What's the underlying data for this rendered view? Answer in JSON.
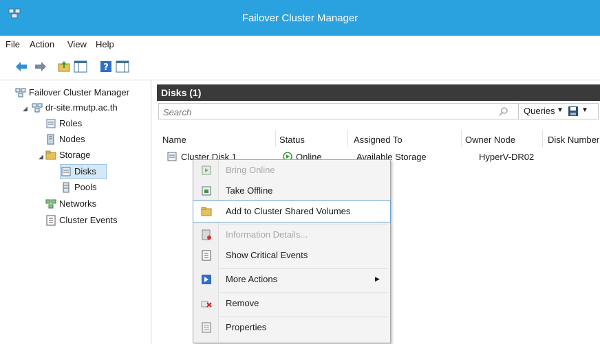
{
  "window": {
    "title": "Failover Cluster Manager"
  },
  "menubar": {
    "items": [
      "File",
      "Action",
      "View",
      "Help"
    ]
  },
  "tree": {
    "root": "Failover Cluster Manager",
    "cluster": "dr-site.rmutp.ac.th",
    "roles": "Roles",
    "nodes": "Nodes",
    "storage": "Storage",
    "disks": "Disks",
    "pools": "Pools",
    "networks": "Networks",
    "events": "Cluster Events"
  },
  "pane": {
    "title": "Disks (1)",
    "search_placeholder": "Search",
    "queries_label": "Queries"
  },
  "table": {
    "columns": [
      "Name",
      "Status",
      "Assigned To",
      "Owner Node",
      "Disk Number"
    ],
    "rows": [
      {
        "name": "Cluster Disk 1",
        "status": "Online",
        "assigned_to": "Available Storage",
        "owner_node": "HyperV-DR02"
      }
    ]
  },
  "context_menu": {
    "items": [
      {
        "label": "Bring Online",
        "enabled": false,
        "icon": "bring-online-icon"
      },
      {
        "label": "Take Offline",
        "enabled": true,
        "icon": "take-offline-icon"
      },
      {
        "label": "Add to Cluster Shared Volumes",
        "enabled": true,
        "highlighted": true,
        "icon": "add-csv-icon"
      },
      {
        "label": "Information Details...",
        "enabled": false,
        "icon": "info-details-icon"
      },
      {
        "label": "Show Critical Events",
        "enabled": true,
        "icon": "critical-events-icon"
      },
      {
        "label": "More Actions",
        "enabled": true,
        "has_submenu": true,
        "icon": "more-actions-icon"
      },
      {
        "label": "Remove",
        "enabled": true,
        "icon": "remove-icon"
      },
      {
        "label": "Properties",
        "enabled": true,
        "icon": "properties-icon"
      }
    ]
  },
  "colors": {
    "titlebar": "#2aa2e0",
    "pane_header": "#3a3a3a",
    "highlight_border": "#6aa3d6"
  }
}
